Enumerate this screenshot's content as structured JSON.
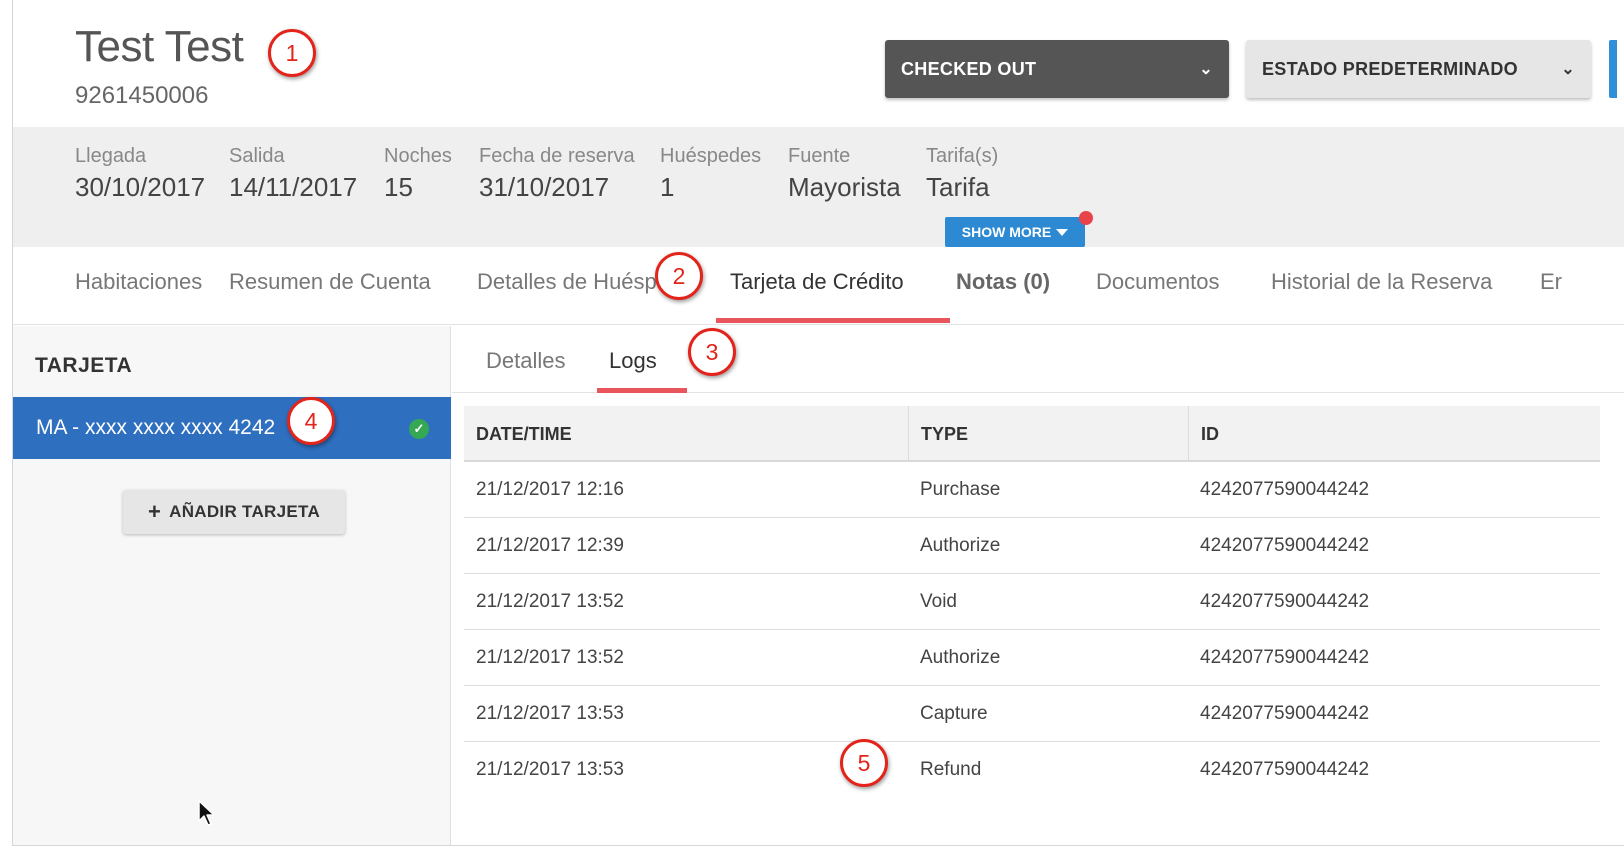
{
  "header": {
    "guest_name": "Test Test",
    "reservation_number": "9261450006",
    "status_dropdown": "CHECKED OUT",
    "state_dropdown": "ESTADO PREDETERMINADO"
  },
  "info": [
    {
      "label": "Llegada",
      "value": "30/10/2017"
    },
    {
      "label": "Salida",
      "value": "14/11/2017"
    },
    {
      "label": "Noches",
      "value": "15"
    },
    {
      "label": "Fecha de reserva",
      "value": "31/10/2017"
    },
    {
      "label": "Huéspedes",
      "value": "1"
    },
    {
      "label": "Fuente",
      "value": "Mayorista"
    },
    {
      "label": "Tarifa(s)",
      "value": "Tarifa"
    }
  ],
  "show_more_label": "SHOW MORE",
  "tabs": [
    {
      "label": "Habitaciones"
    },
    {
      "label": "Resumen de Cuenta"
    },
    {
      "label": "Detalles de Huésp"
    },
    {
      "label": "Tarjeta de Crédito"
    },
    {
      "label": "Notas (0)"
    },
    {
      "label": "Documentos"
    },
    {
      "label": "Historial de la Reserva"
    },
    {
      "label": "Er"
    }
  ],
  "card_panel": {
    "title": "TARJETA",
    "card_label": "MA - xxxx xxxx xxxx 4242",
    "check_glyph": "✓",
    "add_button": "AÑADIR TARJETA"
  },
  "subtabs": [
    {
      "label": "Detalles"
    },
    {
      "label": "Logs"
    }
  ],
  "table": {
    "headers": [
      "DATE/TIME",
      "TYPE",
      "ID"
    ],
    "rows": [
      {
        "datetime": "21/12/2017 12:16",
        "type": "Purchase",
        "id": "4242077590044242"
      },
      {
        "datetime": "21/12/2017 12:39",
        "type": "Authorize",
        "id": "4242077590044242"
      },
      {
        "datetime": "21/12/2017 13:52",
        "type": "Void",
        "id": "4242077590044242"
      },
      {
        "datetime": "21/12/2017 13:52",
        "type": "Authorize",
        "id": "4242077590044242"
      },
      {
        "datetime": "21/12/2017 13:53",
        "type": "Capture",
        "id": "4242077590044242"
      },
      {
        "datetime": "21/12/2017 13:53",
        "type": "Refund",
        "id": "4242077590044242"
      }
    ]
  },
  "markers": [
    "1",
    "2",
    "3",
    "4",
    "5"
  ],
  "colors": {
    "accent_blue": "#2f6fbf",
    "tab_underline": "#e8555c",
    "marker_red": "#e2241b",
    "status_dark": "#555555"
  }
}
